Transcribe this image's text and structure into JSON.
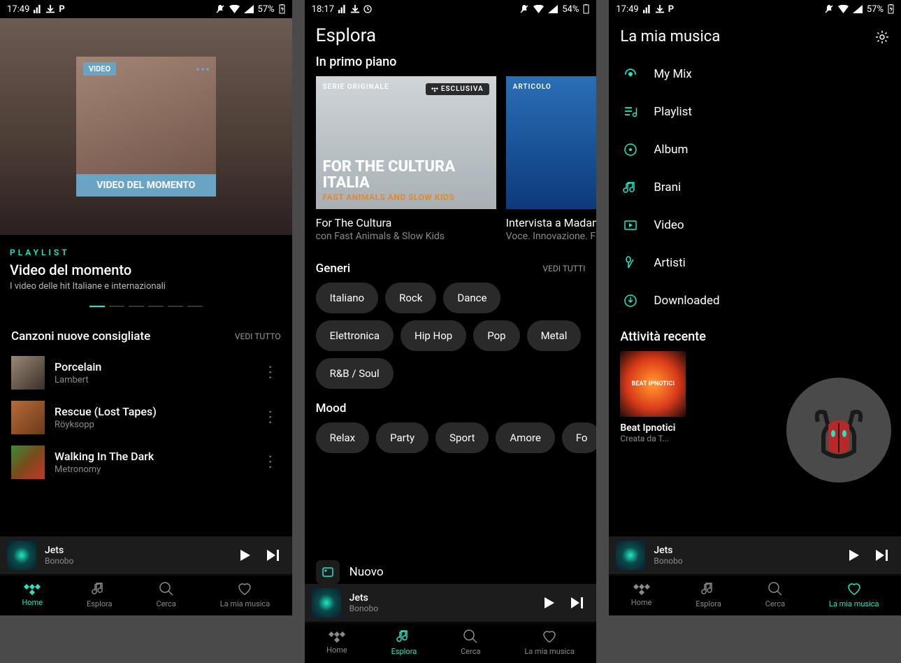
{
  "screen1": {
    "status": {
      "time": "17:49",
      "battery": "57%"
    },
    "hero": {
      "badge_top": "VIDEO",
      "badge_bottom": "VIDEO DEL MOMENTO",
      "tag": "PLAYLIST",
      "title": "Video del momento",
      "subtitle": "I video delle hit Italiane e internazionali"
    },
    "section": {
      "title": "Canzoni nuove consigliate",
      "see_all": "VEDI TUTTO"
    },
    "tracks": [
      {
        "title": "Porcelain",
        "artist": "Lambert"
      },
      {
        "title": "Rescue (Lost Tapes)",
        "artist": "Röyksopp"
      },
      {
        "title": "Walking In The Dark",
        "artist": "Metronomy"
      }
    ],
    "player": {
      "title": "Jets",
      "artist": "Bonobo"
    },
    "nav": {
      "home": "Home",
      "explore": "Esplora",
      "search": "Cerca",
      "mymusic": "La mia musica"
    }
  },
  "screen2": {
    "status": {
      "time": "18:17",
      "battery": "54%"
    },
    "title": "Esplora",
    "featured_label": "In primo piano",
    "cards": [
      {
        "kicker": "SERIE ORIGINALE",
        "pill": "ESCLUSIVA",
        "headline": "FOR THE CULTURA ITALIA",
        "sub": "FAST ANIMALS AND SLOW KIDS",
        "title": "For The Cultura",
        "subtitle": "con Fast Animals & Slow Kids"
      },
      {
        "kicker": "ARTICOLO",
        "title": "Intervista a Madame",
        "subtitle": "Voce. Innovazione. F"
      }
    ],
    "genres": {
      "label": "Generi",
      "see_all": "VEDI TUTTI",
      "items": [
        "Italiano",
        "Rock",
        "Dance",
        "Elettronica",
        "Hip Hop",
        "Pop",
        "Metal",
        "R&B / Soul"
      ]
    },
    "mood": {
      "label": "Mood",
      "items": [
        "Relax",
        "Party",
        "Sport",
        "Amore",
        "Fo"
      ]
    },
    "nuovo": "Nuovo",
    "player": {
      "title": "Jets",
      "artist": "Bonobo"
    },
    "nav": {
      "home": "Home",
      "explore": "Esplora",
      "search": "Cerca",
      "mymusic": "La mia musica"
    }
  },
  "screen3": {
    "status": {
      "time": "17:49",
      "battery": "57%"
    },
    "title": "La mia musica",
    "menu": [
      {
        "label": "My Mix",
        "icon": "mix"
      },
      {
        "label": "Playlist",
        "icon": "playlist"
      },
      {
        "label": "Album",
        "icon": "album"
      },
      {
        "label": "Brani",
        "icon": "track"
      },
      {
        "label": "Video",
        "icon": "video"
      },
      {
        "label": "Artisti",
        "icon": "artist"
      },
      {
        "label": "Downloaded",
        "icon": "download"
      }
    ],
    "recent": {
      "label": "Attività recente",
      "title": "Beat Ipnotici",
      "subtitle": "Creata da T...",
      "art_text": "BEAT IPNOTICI"
    },
    "player": {
      "title": "Jets",
      "artist": "Bonobo"
    },
    "nav": {
      "home": "Home",
      "explore": "Esplora",
      "search": "Cerca",
      "mymusic": "La mia musica"
    }
  }
}
